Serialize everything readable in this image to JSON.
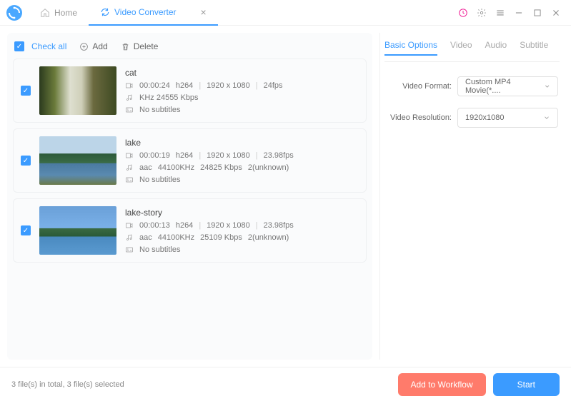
{
  "header": {
    "home_label": "Home",
    "converter_label": "Video Converter"
  },
  "toolbar": {
    "check_all": "Check all",
    "add": "Add",
    "delete": "Delete"
  },
  "items": [
    {
      "title": "cat",
      "duration": "00:00:24",
      "vcodec": "h264",
      "resolution": "1920 x 1080",
      "fps": "24fps",
      "audio_line": "KHz   24555 Kbps",
      "subtitles": "No subtitles",
      "has_acodec": false
    },
    {
      "title": "lake",
      "duration": "00:00:19",
      "vcodec": "h264",
      "resolution": "1920 x 1080",
      "fps": "23.98fps",
      "acodec": "aac",
      "arate": "44100KHz",
      "abitrate": "24825 Kbps",
      "achannels": "2(unknown)",
      "subtitles": "No subtitles",
      "has_acodec": true
    },
    {
      "title": "lake-story",
      "duration": "00:00:13",
      "vcodec": "h264",
      "resolution": "1920 x 1080",
      "fps": "23.98fps",
      "acodec": "aac",
      "arate": "44100KHz",
      "abitrate": "25109 Kbps",
      "achannels": "2(unknown)",
      "subtitles": "No subtitles",
      "has_acodec": true
    }
  ],
  "sidebar": {
    "tabs": {
      "basic": "Basic Options",
      "video": "Video",
      "audio": "Audio",
      "subtitle": "Subtitle"
    },
    "format_label": "Video Format:",
    "format_value": "Custom MP4 Movie(*....",
    "resolution_label": "Video Resolution:",
    "resolution_value": "1920x1080"
  },
  "footer": {
    "status": "3 file(s) in total, 3 file(s) selected",
    "workflow": "Add to Workflow",
    "start": "Start"
  },
  "thumbs": [
    "linear-gradient(90deg,#2b3a1e 0%,#6a7a3a 20%,#dedfd0 40%,#cfcfb8 55%,#6b6a3f 70%,#3d4a22 100%)",
    "linear-gradient(180deg,#bcd5e8 0%,#bcd5e8 35%,#2d5a3a 36%,#3a6b45 55%,#4a7aa0 56%,#5a8ab0 80%,#6a7a4a 100%)",
    "linear-gradient(180deg,#6aa0d8 0%,#7ab0e8 45%,#3a6a42 46%,#2a5a38 62%,#4a8ac0 63%,#5a9ad0 100%)"
  ]
}
